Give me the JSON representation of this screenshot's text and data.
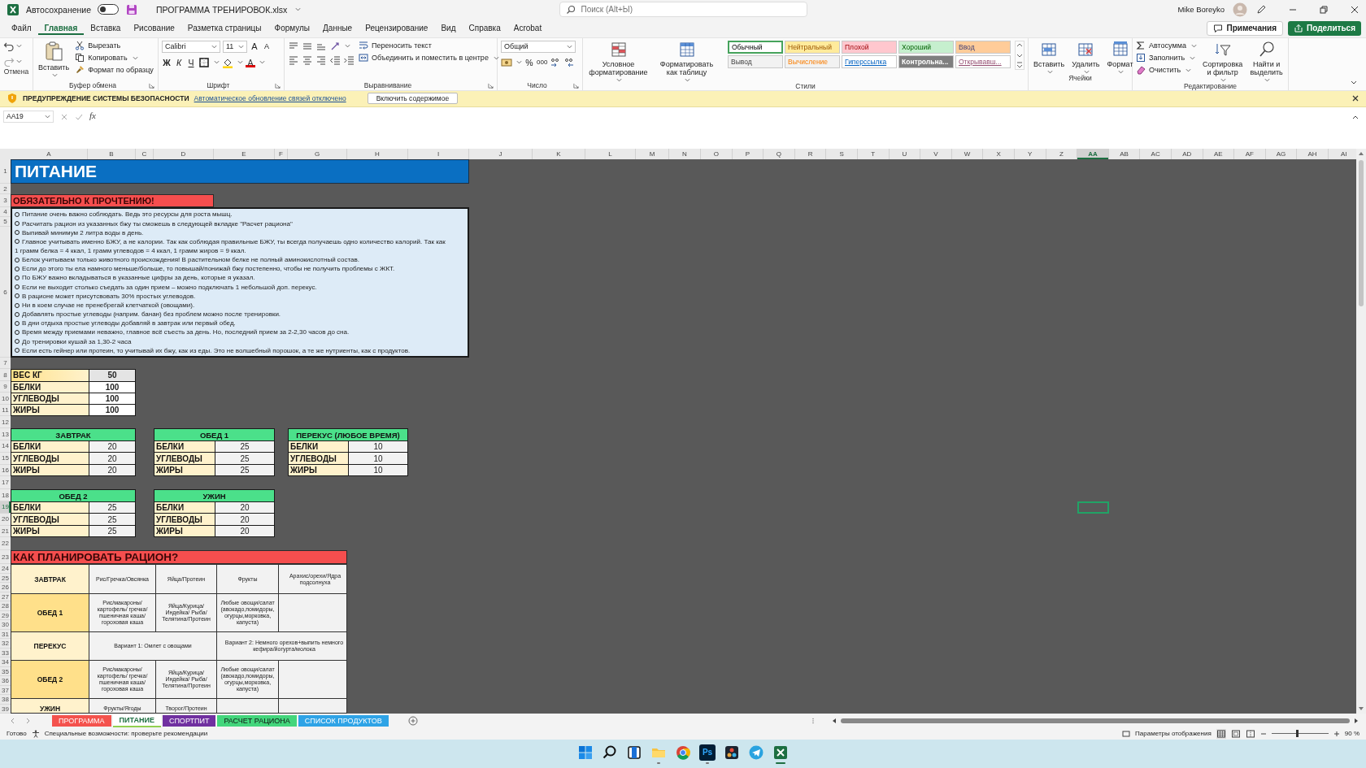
{
  "app": {
    "autosave_label": "Автосохранение",
    "autosave_on": false,
    "file_name": "ПРОГРАММА ТРЕНИРОВОК.xlsx",
    "search_placeholder": "Поиск (Alt+Ы)",
    "user_name": "Mike Boreyko"
  },
  "menu_tabs": [
    {
      "label": "Файл",
      "selected": false
    },
    {
      "label": "Главная",
      "selected": true
    },
    {
      "label": "Вставка",
      "selected": false
    },
    {
      "label": "Рисование",
      "selected": false
    },
    {
      "label": "Разметка страницы",
      "selected": false
    },
    {
      "label": "Формулы",
      "selected": false
    },
    {
      "label": "Данные",
      "selected": false
    },
    {
      "label": "Рецензирование",
      "selected": false
    },
    {
      "label": "Вид",
      "selected": false
    },
    {
      "label": "Справка",
      "selected": false
    },
    {
      "label": "Acrobat",
      "selected": false
    }
  ],
  "comments_button": "Примечания",
  "share_button": "Поделиться",
  "ribbon": {
    "undo": {
      "group_label": "Отмена"
    },
    "clipboard": {
      "paste": "Вставить",
      "actions": [
        "Вырезать",
        "Копировать",
        "Формат по образцу"
      ],
      "group_label": "Буфер обмена"
    },
    "font": {
      "name": "Calibri",
      "size": "11",
      "size_buttons": [
        "A",
        "A"
      ],
      "style_buttons": [
        "Ж",
        "К",
        "Ч"
      ],
      "color_button": "A",
      "group_label": "Шрифт"
    },
    "alignment": {
      "wrap": "Переносить текст",
      "merge": "Объединить и поместить в центре",
      "group_label": "Выравнивание"
    },
    "number": {
      "format": "Общий",
      "percent": "%",
      "thousands": "000",
      "group_label": "Число"
    },
    "styles": {
      "buttons": [
        "Условное форматирование",
        "Форматировать как таблицу"
      ],
      "group_label": "Стили",
      "cells": [
        {
          "label": "Обычный",
          "kind": "plain",
          "color": "#ffffff",
          "selected": true
        },
        {
          "label": "Нейтральный",
          "kind": "plain",
          "color": "#ffeb9c",
          "selected": false
        },
        {
          "label": "Плохой",
          "kind": "plain",
          "color": "#ffc7ce",
          "selected": false
        },
        {
          "label": "Хороший",
          "kind": "plain",
          "color": "#c6efce",
          "selected": false
        },
        {
          "label": "Ввод",
          "kind": "plain",
          "color": "#ffcc99",
          "selected": false
        },
        {
          "label": "Вывод",
          "kind": "plain",
          "color": "#f2f2f2",
          "selected": false
        },
        {
          "label": "Вычисление",
          "kind": "plain",
          "color": "#f2f2f2",
          "selected": false
        },
        {
          "label": "Гиперссылка",
          "kind": "link",
          "color": "#ffffff",
          "selected": false
        },
        {
          "label": "Контрольна...",
          "kind": "check",
          "color": "#7f7f7f",
          "selected": false
        },
        {
          "label": "Открывавш...",
          "kind": "link",
          "color": "#ffffff",
          "selected": false
        }
      ]
    },
    "cells": {
      "buttons": [
        "Вставить",
        "Удалить",
        "Формат"
      ],
      "group_label": "Ячейки"
    },
    "editing": {
      "actions": [
        "Автосумма",
        "Заполнить",
        "Очистить"
      ],
      "buttons": [
        "Сортировка и фильтр",
        "Найти и выделить"
      ],
      "group_label": "Редактирование"
    }
  },
  "security_bar": {
    "title": "ПРЕДУПРЕЖДЕНИЕ СИСТЕМЫ БЕЗОПАСНОСТИ",
    "message": "Автоматическое обновление связей отключено",
    "button": "Включить содержимое"
  },
  "formula_bar": {
    "name_box": "AA19",
    "fx": "fx"
  },
  "columns": [
    {
      "label": "A",
      "selected": false
    },
    {
      "label": "B",
      "selected": false
    },
    {
      "label": "C",
      "selected": false
    },
    {
      "label": "D",
      "selected": false
    },
    {
      "label": "E",
      "selected": false
    },
    {
      "label": "F",
      "selected": false
    },
    {
      "label": "G",
      "selected": false
    },
    {
      "label": "H",
      "selected": false
    },
    {
      "label": "I",
      "selected": false
    },
    {
      "label": "J",
      "selected": false
    },
    {
      "label": "K",
      "selected": false
    },
    {
      "label": "L",
      "selected": false
    },
    {
      "label": "M",
      "selected": false
    },
    {
      "label": "N",
      "selected": false
    },
    {
      "label": "O",
      "selected": false
    },
    {
      "label": "P",
      "selected": false
    },
    {
      "label": "Q",
      "selected": false
    },
    {
      "label": "R",
      "selected": false
    },
    {
      "label": "S",
      "selected": false
    },
    {
      "label": "T",
      "selected": false
    },
    {
      "label": "U",
      "selected": false
    },
    {
      "label": "V",
      "selected": false
    },
    {
      "label": "W",
      "selected": false
    },
    {
      "label": "X",
      "selected": false
    },
    {
      "label": "Y",
      "selected": false
    },
    {
      "label": "Z",
      "selected": false
    },
    {
      "label": "AA",
      "selected": true
    },
    {
      "label": "AB",
      "selected": false
    },
    {
      "label": "AC",
      "selected": false
    },
    {
      "label": "AD",
      "selected": false
    },
    {
      "label": "AE",
      "selected": false
    },
    {
      "label": "AF",
      "selected": false
    },
    {
      "label": "AG",
      "selected": false
    },
    {
      "label": "AH",
      "selected": false
    },
    {
      "label": "AI",
      "selected": false
    }
  ],
  "rows": [
    {
      "label": "1",
      "selected": false
    },
    {
      "label": "2",
      "selected": false
    },
    {
      "label": "3",
      "selected": false
    },
    {
      "label": "4",
      "selected": false
    },
    {
      "label": "5",
      "selected": false
    },
    {
      "label": "6",
      "selected": false
    },
    {
      "label": "7",
      "selected": false
    },
    {
      "label": "8",
      "selected": false
    },
    {
      "label": "9",
      "selected": false
    },
    {
      "label": "10",
      "selected": false
    },
    {
      "label": "11",
      "selected": false
    },
    {
      "label": "12",
      "selected": false
    },
    {
      "label": "13",
      "selected": false
    },
    {
      "label": "14",
      "selected": false
    },
    {
      "label": "15",
      "selected": false
    },
    {
      "label": "16",
      "selected": false
    },
    {
      "label": "17",
      "selected": false
    },
    {
      "label": "18",
      "selected": false
    },
    {
      "label": "19",
      "selected": true
    },
    {
      "label": "20",
      "selected": false
    },
    {
      "label": "21",
      "selected": false
    },
    {
      "label": "22",
      "selected": false
    },
    {
      "label": "23",
      "selected": false
    },
    {
      "label": "24",
      "selected": false
    },
    {
      "label": "25",
      "selected": false
    },
    {
      "label": "26",
      "selected": false
    },
    {
      "label": "27",
      "selected": false
    },
    {
      "label": "28",
      "selected": false
    },
    {
      "label": "29",
      "selected": false
    },
    {
      "label": "30",
      "selected": false
    },
    {
      "label": "31",
      "selected": false
    },
    {
      "label": "32",
      "selected": false
    },
    {
      "label": "33",
      "selected": false
    },
    {
      "label": "34",
      "selected": false
    },
    {
      "label": "35",
      "selected": false
    },
    {
      "label": "36",
      "selected": false
    },
    {
      "label": "37",
      "selected": false
    },
    {
      "label": "38",
      "selected": false
    },
    {
      "label": "39",
      "selected": false
    }
  ],
  "sheet": {
    "title": "ПИТАНИЕ",
    "notice": {
      "heading": "ОБЯЗАТЕЛЬНО К ПРОЧТЕНИЮ!",
      "lines": [
        {
          "kind": "bullet",
          "text": "Питание очень важно соблюдать. Ведь это ресурсы для роста мышц."
        },
        {
          "kind": "bullet",
          "text": "Расчитать рацион из указанных бжу ты сможешь в следующей вкладке \"Расчет рациона\""
        },
        {
          "kind": "bullet",
          "text": "Выпивай минимум 2 литра воды в день."
        },
        {
          "kind": "bullet",
          "text": "Главное учитывать именно БЖУ, а не калории. Так как соблюдая правильные БЖУ, ты всегда получаешь одно количество калорий. Так как"
        },
        {
          "kind": "continuation",
          "text": "1 грамм белка = 4 ккал, 1 грамм углеводов = 4 ккал, 1 грамм жиров = 9 ккал."
        },
        {
          "kind": "bullet",
          "text": "Белок учитываем только животного происхождения! В растительном белке не полный аминокислотный состав."
        },
        {
          "kind": "bullet",
          "text": "Если до этого ты ела намного меньше/больше, то повышай/понижай бжу постепенно, чтобы не получить проблемы с ЖКТ."
        },
        {
          "kind": "bullet",
          "text": "По БЖУ важно вкладываться в указанные цифры за день, которые я указал."
        },
        {
          "kind": "bullet",
          "text": "Если не выходит столько съедать за один прием – можно подключать 1 небольшой доп. перекус."
        },
        {
          "kind": "bullet",
          "text": "В рационе может присутсвовать 30% простых углеводов."
        },
        {
          "kind": "bullet",
          "text": "Ни в коем случае не пренебрегай клетчаткой (овощами)."
        },
        {
          "kind": "bullet",
          "text": "Добавлять простые углеводы (наприм. банан) без проблем можно после тренировки."
        },
        {
          "kind": "bullet",
          "text": "В дни отдыха простые углеводы добавляй в завтрак или первый обед."
        },
        {
          "kind": "bullet",
          "text": "Время между приемами неважно, главное всё съесть за день. Но, последний прием за 2-2,30 часов до сна."
        },
        {
          "kind": "bullet",
          "text": "До тренировки кушай за 1,30-2 часа"
        },
        {
          "kind": "bullet",
          "text": "Если есть гейнер или протеин, то учитывай их бжу, как из еды. Это не волшебный порошок, а те же нутриенты, как с продуктов."
        }
      ]
    },
    "body_stats": [
      {
        "label": "ВЕС КГ",
        "value": "50"
      },
      {
        "label": "БЕЛКИ",
        "value": "100"
      },
      {
        "label": "УГЛЕВОДЫ",
        "value": "100"
      },
      {
        "label": "ЖИРЫ",
        "value": "100"
      }
    ],
    "meals": [
      {
        "title": "ЗАВТРАК",
        "rows": [
          {
            "label": "БЕЛКИ",
            "value": "20"
          },
          {
            "label": "УГЛЕВОДЫ",
            "value": "20"
          },
          {
            "label": "ЖИРЫ",
            "value": "20"
          }
        ]
      },
      {
        "title": "ОБЕД 1",
        "rows": [
          {
            "label": "БЕЛКИ",
            "value": "25"
          },
          {
            "label": "УГЛЕВОДЫ",
            "value": "25"
          },
          {
            "label": "ЖИРЫ",
            "value": "25"
          }
        ]
      },
      {
        "title": "ПЕРЕКУС (ЛЮБОЕ ВРЕМЯ)",
        "rows": [
          {
            "label": "БЕЛКИ",
            "value": "10"
          },
          {
            "label": "УГЛЕВОДЫ",
            "value": "10"
          },
          {
            "label": "ЖИРЫ",
            "value": "10"
          }
        ]
      },
      {
        "title": "ОБЕД 2",
        "rows": [
          {
            "label": "БЕЛКИ",
            "value": "25"
          },
          {
            "label": "УГЛЕВОДЫ",
            "value": "25"
          },
          {
            "label": "ЖИРЫ",
            "value": "25"
          }
        ]
      },
      {
        "title": "УЖИН",
        "rows": [
          {
            "label": "БЕЛКИ",
            "value": "20"
          },
          {
            "label": "УГЛЕВОДЫ",
            "value": "20"
          },
          {
            "label": "ЖИРЫ",
            "value": "20"
          }
        ]
      }
    ],
    "plan": {
      "heading": "КАК ПЛАНИРОВАТЬ РАЦИОН?",
      "rows": [
        {
          "meal": "ЗАВТРАК",
          "color": "#fff2cc",
          "cells": [
            {
              "kind": "single",
              "text": "Рис/Гречка/Овсянка"
            },
            {
              "kind": "single",
              "text": "Яйца/Протеин"
            },
            {
              "kind": "single",
              "text": "Фрукты"
            },
            {
              "kind": "single",
              "text": "Арахис/орехи/Ядра подсолнуха"
            }
          ]
        },
        {
          "meal": "ОБЕД 1",
          "color": "#ffe08a",
          "cells": [
            {
              "kind": "single",
              "text": "Рис/макароны/картофель/ гречка/пшеничная каша/гороховая каша"
            },
            {
              "kind": "single",
              "text": "Яйца/Курица/Индейка/ Рыба/Телятина/Протеин"
            },
            {
              "kind": "single",
              "text": "Любые овощи/салат (авокадо,помидоры, огурцы,морковка, капуста)"
            }
          ]
        },
        {
          "meal": "ПЕРЕКУС",
          "color": "#fff2cc",
          "cells": [
            {
              "kind": "wide",
              "text": "Вариант 1: Омлет с овощами"
            },
            {
              "kind": "covered"
            },
            {
              "kind": "wide",
              "text": "Вариант 2: Немного орехов+выпить немного кефира/йогурта/молока"
            },
            {
              "kind": "covered"
            }
          ]
        },
        {
          "meal": "ОБЕД 2",
          "color": "#ffe08a",
          "cells": [
            {
              "kind": "single",
              "text": "Рис/макароны/картофель/ гречка/пшеничная каша/гороховая каша"
            },
            {
              "kind": "single",
              "text": "Яйца/Курица/Индейка/ Рыба/Телятина/Протеин"
            },
            {
              "kind": "single",
              "text": "Любые овощи/салат (авокадо,помидоры, огурцы,морковка, капуста)"
            }
          ]
        },
        {
          "meal": "УЖИН",
          "color": "#fff2cc",
          "cells": [
            {
              "kind": "single",
              "text": "Фрукты/Ягоды"
            },
            {
              "kind": "single",
              "text": "Творог/Протеин"
            }
          ]
        }
      ]
    }
  },
  "sheet_tabs": [
    {
      "label": "ПРОГРАММА",
      "color": "#f4524d",
      "selected": false
    },
    {
      "label": "ПИТАНИЕ",
      "color": "#92d050",
      "selected": true
    },
    {
      "label": "СПОРТПИТ",
      "color": "#7030a0",
      "selected": false
    },
    {
      "label": "РАСЧЕТ РАЦИОНА",
      "color": "#43d67c",
      "selected": false
    },
    {
      "label": "СПИСОК ПРОДУКТОВ",
      "color": "#2ea3e6",
      "selected": false
    }
  ],
  "status_bar": {
    "ready": "Готово",
    "accessibility": "Специальные возможности: проверьте рекомендации",
    "display_settings": "Параметры отображения",
    "zoom": {
      "label": "90 %",
      "level": 0.45
    }
  },
  "taskbar": [
    {
      "kind": "start",
      "running": false
    },
    {
      "kind": "search",
      "running": false
    },
    {
      "kind": "widgets",
      "running": false
    },
    {
      "kind": "explorer",
      "running": true
    },
    {
      "kind": "browser",
      "running": false
    },
    {
      "kind": "photoshop",
      "label": "Ps",
      "running": true
    },
    {
      "kind": "editor",
      "running": false
    },
    {
      "kind": "telegram",
      "running": false
    },
    {
      "kind": "excel",
      "running": true
    }
  ]
}
